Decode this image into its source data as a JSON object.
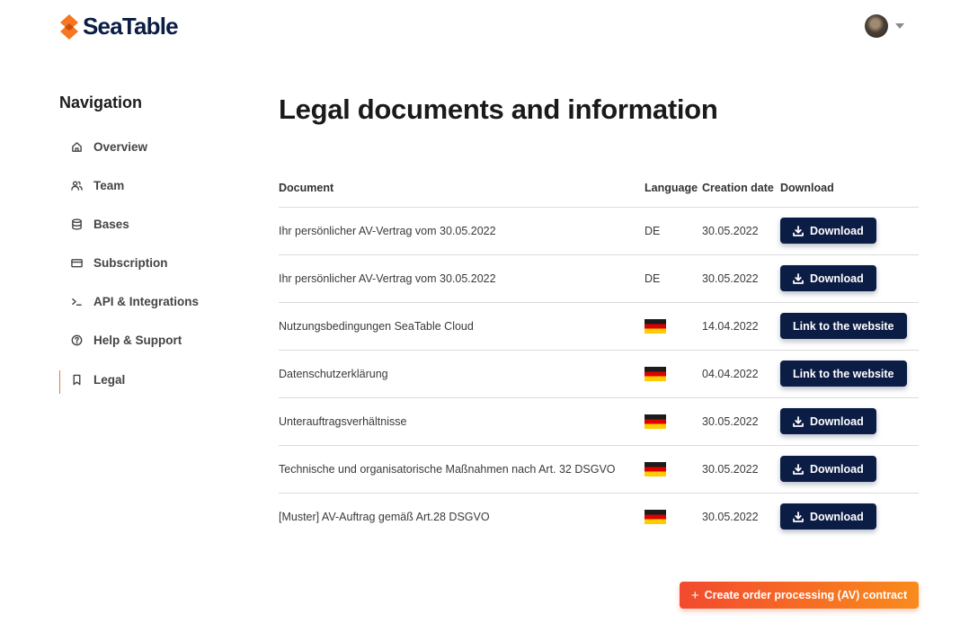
{
  "brand": {
    "name": "SeaTable",
    "accent": "#f7761f",
    "navy": "#0b1d44"
  },
  "user": {
    "avatar_icon": "user-avatar",
    "menu_icon": "caret-down-icon"
  },
  "sidebar": {
    "title": "Navigation",
    "items": [
      {
        "label": "Overview",
        "icon": "home-icon"
      },
      {
        "label": "Team",
        "icon": "users-icon"
      },
      {
        "label": "Bases",
        "icon": "database-icon"
      },
      {
        "label": "Subscription",
        "icon": "credit-card-icon"
      },
      {
        "label": "API & Integrations",
        "icon": "terminal-icon"
      },
      {
        "label": "Help & Support",
        "icon": "help-circle-icon"
      },
      {
        "label": "Legal",
        "icon": "bookmark-icon",
        "active": true
      }
    ]
  },
  "main": {
    "title": "Legal documents and information",
    "table": {
      "headers": [
        "Document",
        "Language",
        "Creation date",
        "Download"
      ],
      "rows": [
        {
          "document": "Ihr persönlicher AV-Vertrag vom 30.05.2022",
          "language": "DE",
          "date": "30.05.2022",
          "action": "Download"
        },
        {
          "document": "Ihr persönlicher AV-Vertrag vom 30.05.2022",
          "language": "DE",
          "date": "30.05.2022",
          "action": "Download"
        },
        {
          "document": "Nutzungsbedingungen SeaTable Cloud",
          "language_flag": "germany-flag",
          "date": "14.04.2022",
          "action": "Link to the website"
        },
        {
          "document": "Datenschutzerklärung",
          "language_flag": "germany-flag",
          "date": "04.04.2022",
          "action": "Link to the website"
        },
        {
          "document": "Unterauftragsverhältnisse",
          "language_flag": "germany-flag",
          "date": "30.05.2022",
          "action": "Download"
        },
        {
          "document": "Technische und organisatorische Maßnahmen nach Art. 32 DSGVO",
          "language_flag": "germany-flag",
          "date": "30.05.2022",
          "action": "Download"
        },
        {
          "document": "[Muster] AV-Auftrag gemäß Art.28 DSGVO",
          "language_flag": "germany-flag",
          "date": "30.05.2022",
          "action": "Download"
        }
      ]
    },
    "create_button": {
      "icon": "+",
      "label": "Create order processing (AV) contract"
    }
  }
}
